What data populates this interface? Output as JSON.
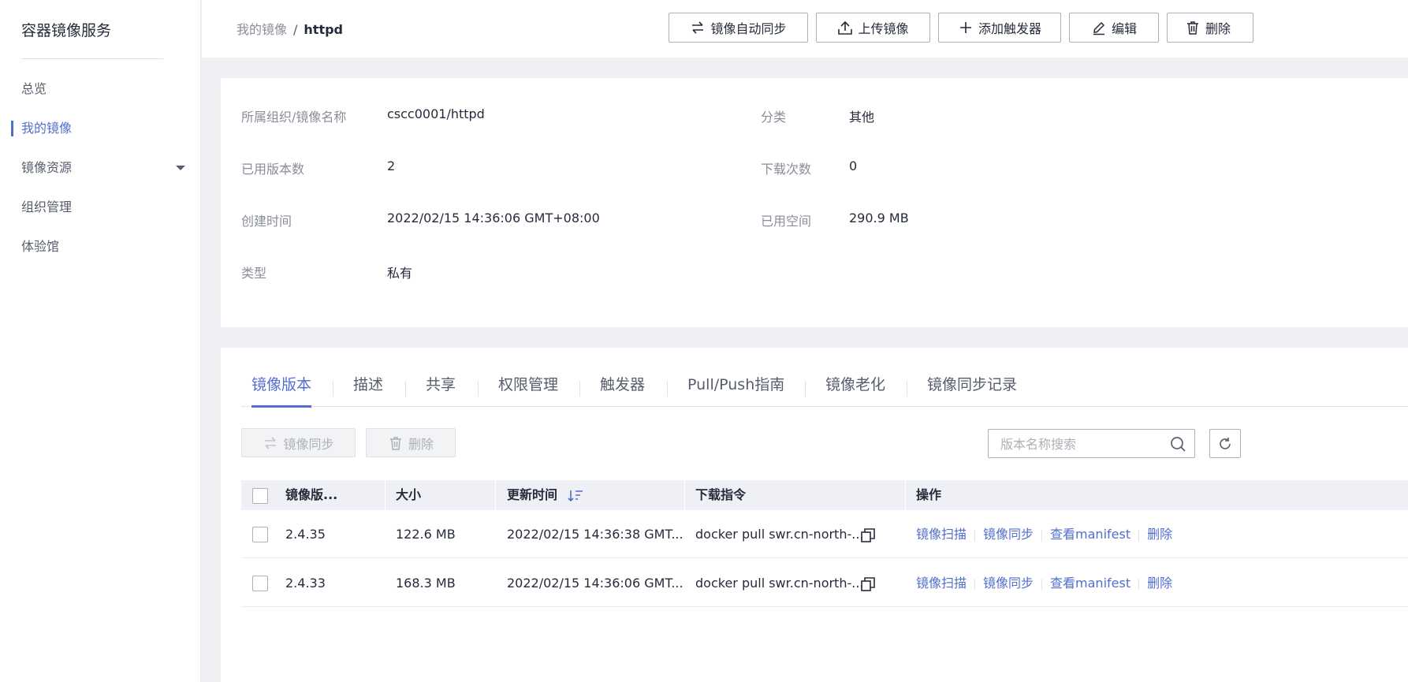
{
  "sidebar": {
    "title": "容器镜像服务",
    "items": [
      {
        "label": "总览"
      },
      {
        "label": "我的镜像"
      },
      {
        "label": "镜像资源"
      },
      {
        "label": "组织管理"
      },
      {
        "label": "体验馆"
      }
    ],
    "active_index": 1
  },
  "breadcrumb": {
    "parent": "我的镜像",
    "separator": "/",
    "current": "httpd"
  },
  "toolbar": {
    "sync_label": "镜像自动同步",
    "upload_label": "上传镜像",
    "trigger_label": "添加触发器",
    "edit_label": "编辑",
    "delete_label": "删除"
  },
  "info": {
    "org_image_label": "所属组织/镜像名称",
    "org_image_value": "cscc0001/httpd",
    "category_label": "分类",
    "category_value": "其他",
    "versions_label": "已用版本数",
    "versions_value": "2",
    "downloads_label": "下载次数",
    "downloads_value": "0",
    "created_label": "创建时间",
    "created_value": "2022/02/15 14:36:06 GMT+08:00",
    "space_label": "已用空间",
    "space_value": "290.9 MB",
    "type_label": "类型",
    "type_value": "私有"
  },
  "tabs": [
    {
      "label": "镜像版本"
    },
    {
      "label": "描述"
    },
    {
      "label": "共享"
    },
    {
      "label": "权限管理"
    },
    {
      "label": "触发器"
    },
    {
      "label": "Pull/Push指南"
    },
    {
      "label": "镜像老化"
    },
    {
      "label": "镜像同步记录"
    }
  ],
  "actions": {
    "sync_label": "镜像同步",
    "delete_label": "删除"
  },
  "search": {
    "placeholder": "版本名称搜索"
  },
  "table": {
    "headers": {
      "version": "镜像版...",
      "size": "大小",
      "updated": "更新时间",
      "command": "下载指令",
      "operations": "操作"
    },
    "rows": [
      {
        "version": "2.4.35",
        "size": "122.6 MB",
        "updated": "2022/02/15 14:36:38 GMT...",
        "command": "docker pull swr.cn-north-..."
      },
      {
        "version": "2.4.33",
        "size": "168.3 MB",
        "updated": "2022/02/15 14:36:06 GMT...",
        "command": "docker pull swr.cn-north-..."
      }
    ],
    "row_actions": {
      "scan": "镜像扫描",
      "sync": "镜像同步",
      "manifest": "查看manifest",
      "delete": "删除"
    }
  },
  "colors": {
    "accent": "#526ecc",
    "text": "#252b3a",
    "muted": "#8a8e99",
    "background": "#eff0f3"
  }
}
